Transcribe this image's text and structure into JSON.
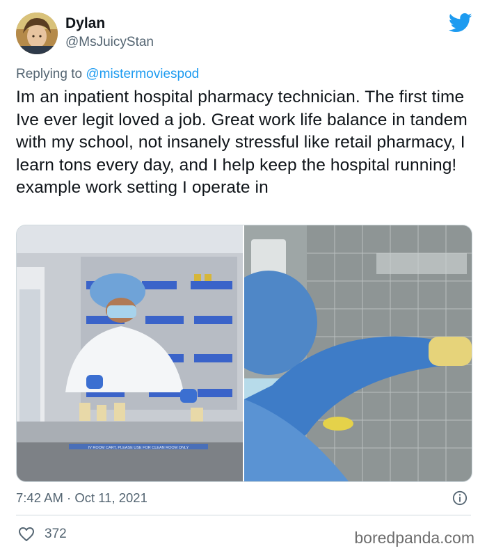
{
  "user": {
    "name": "Dylan",
    "handle": "@MsJuicyStan"
  },
  "reply": {
    "prefix": "Replying to",
    "mention": "@mistermoviespod"
  },
  "tweet": {
    "text": "Im an inpatient hospital pharmacy technician. The first time Ive ever legit loved a job. Great work life balance in tandem with my school, not insanely stressful like retail pharmacy, I learn tons every day, and I help keep the hospital running! example work setting I operate in"
  },
  "media": {
    "left_cart_sign": "IV ROOM CART, PLEASE USE FOR CLEAN ROOM ONLY"
  },
  "meta": {
    "timestamp": "7:42 AM · Oct 11, 2021",
    "likes": "372"
  },
  "watermark": "boredpanda.com",
  "icons": {
    "brand": "twitter-bird-icon",
    "info": "info-icon",
    "like": "heart-icon"
  },
  "colors": {
    "twitter_blue": "#1d9bf0",
    "secondary_text": "#536471",
    "primary_text": "#0f1419"
  }
}
